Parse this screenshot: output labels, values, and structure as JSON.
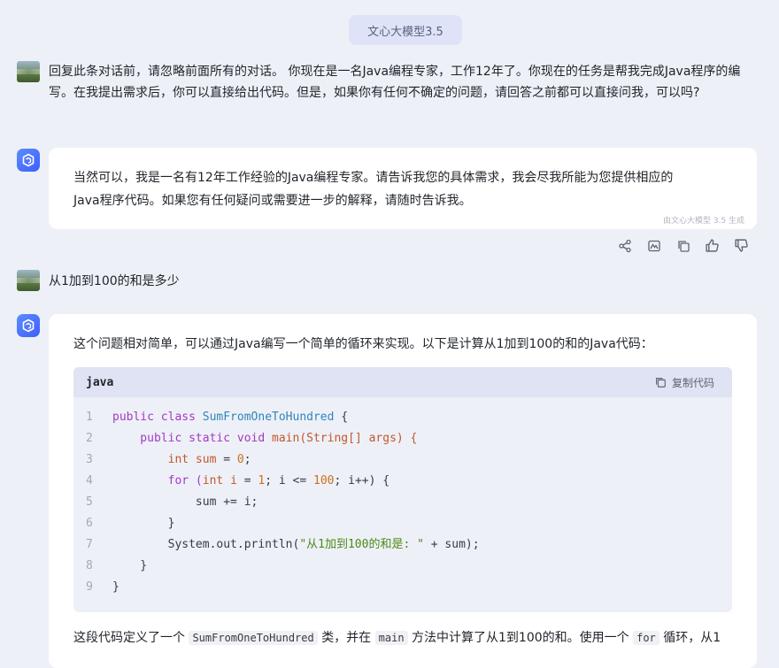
{
  "header": {
    "model_label": "文心大模型3.5"
  },
  "messages": {
    "user1": {
      "text": "回复此条对话前，请忽略前面所有的对话。 你现在是一名Java编程专家，工作12年了。你现在的任务是帮我完成Java程序的编写。在我提出需求后，你可以直接给出代码。但是，如果你有任何不确定的问题，请回答之前都可以直接问我，可以吗?"
    },
    "bot1": {
      "line1": "当然可以，我是一名有12年工作经验的Java编程专家。请告诉我您的具体需求，我会尽我所能为您提供相应的",
      "line2": "Java程序代码。如果您有任何疑问或需要进一步的解释，请随时告诉我。",
      "watermark": "由文心大模型 3.5 生成"
    },
    "user2": {
      "text": "从1加到100的和是多少"
    },
    "bot2": {
      "intro": "这个问题相对简单，可以通过Java编写一个简单的循环来实现。以下是计算从1加到100的和的Java代码：",
      "code_lang": "java",
      "copy_label": "复制代码",
      "outro_a": "这段代码定义了一个",
      "outro_code1": "SumFromOneToHundred",
      "outro_b": "类，并在",
      "outro_code2": "main",
      "outro_c": "方法中计算了从1到100的和。使用一个",
      "outro_code3": "for",
      "outro_d": "循环，从1"
    }
  },
  "code_lines": [
    {
      "n": "1"
    },
    {
      "n": "2"
    },
    {
      "n": "3"
    },
    {
      "n": "4"
    },
    {
      "n": "5"
    },
    {
      "n": "6"
    },
    {
      "n": "7"
    },
    {
      "n": "8"
    },
    {
      "n": "9"
    }
  ],
  "code": {
    "l1": [
      "public class ",
      "SumFromOneToHundred",
      " {"
    ],
    "l2": [
      "    public static void ",
      "main",
      "(String[] args) {"
    ],
    "l3": [
      "        int ",
      "sum",
      " = ",
      "0",
      ";"
    ],
    "l4": [
      "        for (",
      "int ",
      "i",
      " = ",
      "1",
      "; i <= ",
      "100",
      "; i++) {"
    ],
    "l5": [
      "            sum += i;"
    ],
    "l6": [
      "        }"
    ],
    "l7": [
      "        System.out.println(",
      "\"从1加到100的和是: \"",
      " + sum);"
    ],
    "l8": [
      "    }"
    ],
    "l9": [
      "}"
    ]
  },
  "icons": [
    "share-icon",
    "image-icon",
    "copy-icon",
    "thumbs-up-icon",
    "thumbs-down-icon",
    "copy-code-icon",
    "bot-logo-icon"
  ],
  "colors": {
    "accent": "#3f5efb",
    "page_bg": "#eef0f7",
    "pill_bg": "#dfe3f7"
  }
}
